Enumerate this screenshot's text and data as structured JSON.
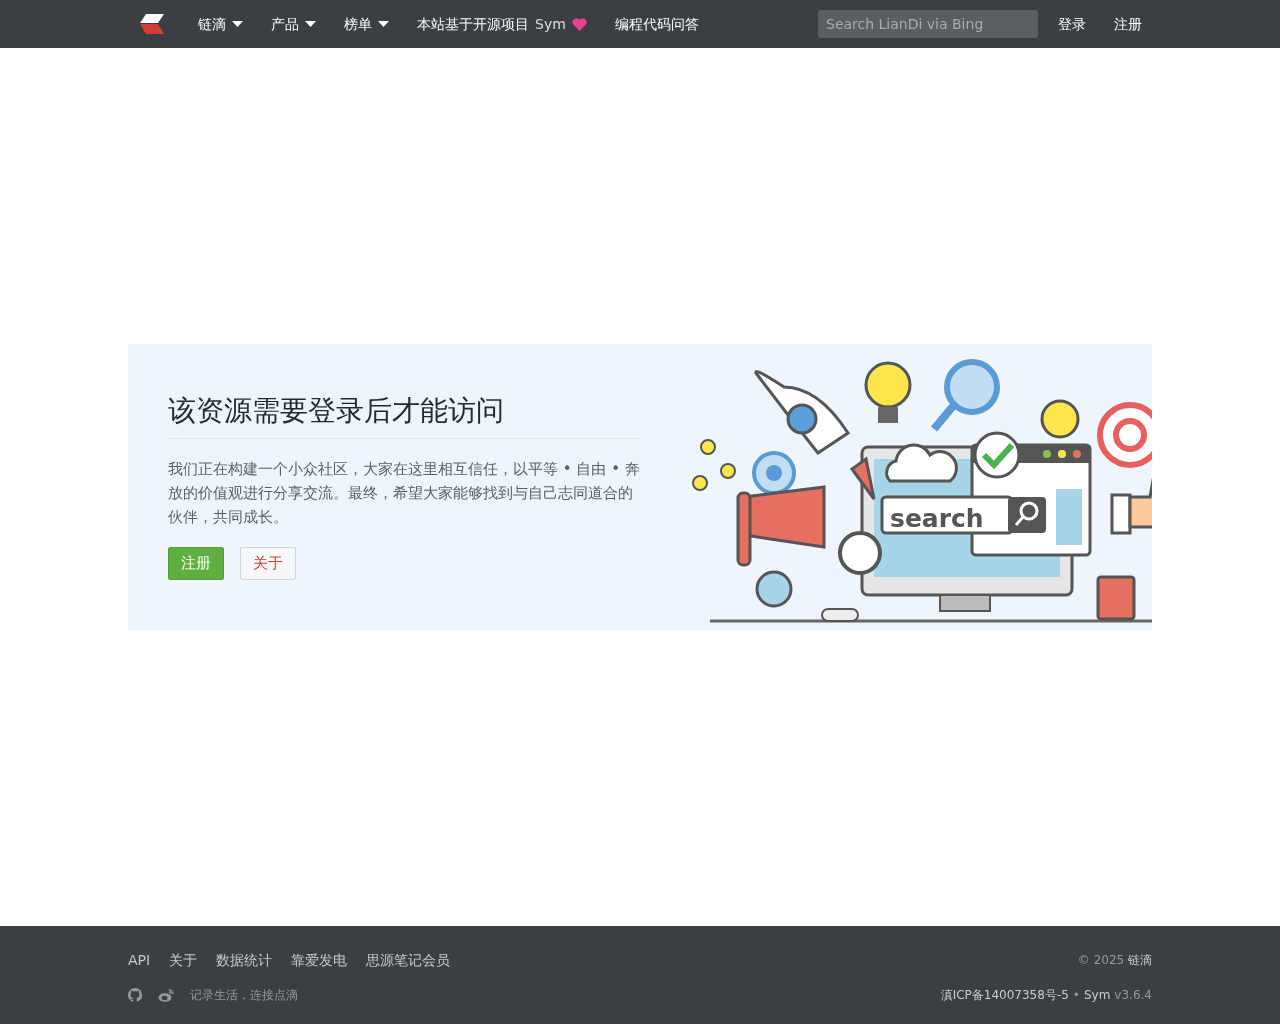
{
  "navbar": {
    "nav_items": [
      {
        "label": "链滴",
        "dropdown": true
      },
      {
        "label": "产品",
        "dropdown": true
      },
      {
        "label": "榜单",
        "dropdown": true
      },
      {
        "label": "本站基于开源项目",
        "suffix": "Sym",
        "heart": true,
        "dropdown": false
      },
      {
        "label": "编程代码问答",
        "dropdown": false
      }
    ],
    "search": {
      "placeholder": "Search LianDi via Bing"
    },
    "links": [
      "登录",
      "注册"
    ]
  },
  "notice": {
    "title": "该资源需要登录后才能访问",
    "text": "我们正在构建一个小众社区，大家在这里相互信任，以平等 • 自由 • 奔放的价值观进行分享交流。最终，希望大家能够找到与自己志同道合的伙伴，共同成长。",
    "buttons": [
      {
        "label": "注册",
        "kind": "primary"
      },
      {
        "label": "关于",
        "kind": "secondary"
      }
    ],
    "illustration": {
      "search_label": "search"
    }
  },
  "footer": {
    "links": [
      "API",
      "关于",
      "数据统计",
      "靠爱发电",
      "思源笔记会员"
    ],
    "slogan": "记录生活，连接点滴",
    "copyright": "© 2025",
    "brand": "链滴",
    "icp": "滇ICP备14007358号-5",
    "separator": "•",
    "sym": "Sym",
    "version": "v3.6.4"
  }
}
